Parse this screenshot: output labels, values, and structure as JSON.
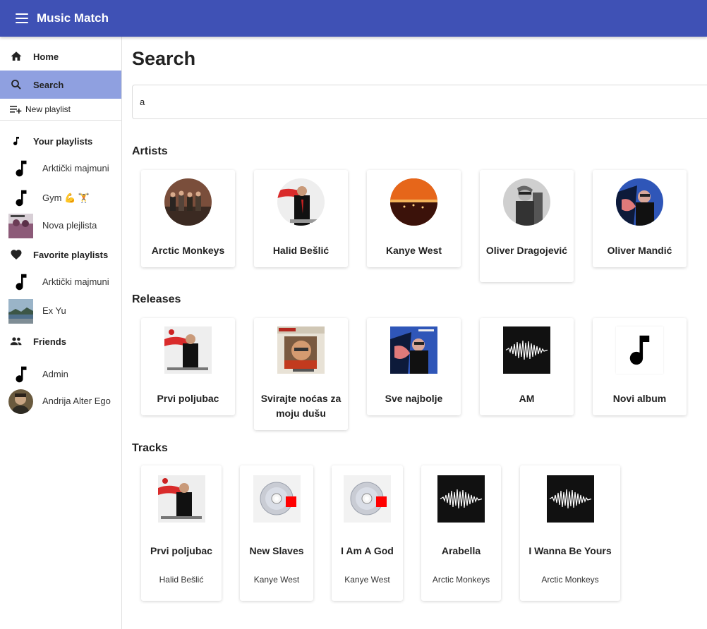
{
  "app": {
    "title": "Music Match"
  },
  "sidebar": {
    "nav": [
      {
        "label": "Home",
        "icon": "home-icon"
      },
      {
        "label": "Search",
        "icon": "search-icon",
        "active": true
      }
    ],
    "new_playlist": "New playlist",
    "your_playlists": {
      "title": "Your playlists",
      "items": [
        {
          "label": "Arktički majmuni",
          "icon": "music-note-icon"
        },
        {
          "label": "Gym 💪 🏋",
          "icon": "music-note-icon"
        },
        {
          "label": "Nova plejlista",
          "icon": "album-cover-image"
        }
      ]
    },
    "favorite_playlists": {
      "title": "Favorite playlists",
      "items": [
        {
          "label": "Arktički majmuni",
          "icon": "music-note-icon"
        },
        {
          "label": "Ex Yu",
          "icon": "landscape-image"
        }
      ]
    },
    "friends": {
      "title": "Friends",
      "items": [
        {
          "label": "Admin",
          "icon": "music-note-icon"
        },
        {
          "label": "Andrija Alter Ego",
          "icon": "avatar-image"
        }
      ]
    }
  },
  "main": {
    "title": "Search",
    "search": {
      "value": "a",
      "placeholder": ""
    },
    "artists_title": "Artists",
    "artists": [
      {
        "name": "Arctic Monkeys"
      },
      {
        "name": "Halid Bešlić"
      },
      {
        "name": "Kanye West"
      },
      {
        "name": "Oliver Dragojević"
      },
      {
        "name": "Oliver Mandić"
      }
    ],
    "releases_title": "Releases",
    "releases": [
      {
        "name": "Prvi poljubac"
      },
      {
        "name": "Svirajte noćas za moju dušu"
      },
      {
        "name": "Sve najbolje"
      },
      {
        "name": "AM"
      },
      {
        "name": "Novi album"
      }
    ],
    "tracks_title": "Tracks",
    "tracks": [
      {
        "name": "Prvi poljubac",
        "artist": "Halid Bešlić"
      },
      {
        "name": "New Slaves",
        "artist": "Kanye West"
      },
      {
        "name": "I Am A God",
        "artist": "Kanye West"
      },
      {
        "name": "Arabella",
        "artist": "Arctic Monkeys"
      },
      {
        "name": "I Wanna Be Yours",
        "artist": "Arctic Monkeys"
      }
    ]
  },
  "colors": {
    "appbar": "#3f51b5",
    "active_nav": "#8fa0e0"
  }
}
